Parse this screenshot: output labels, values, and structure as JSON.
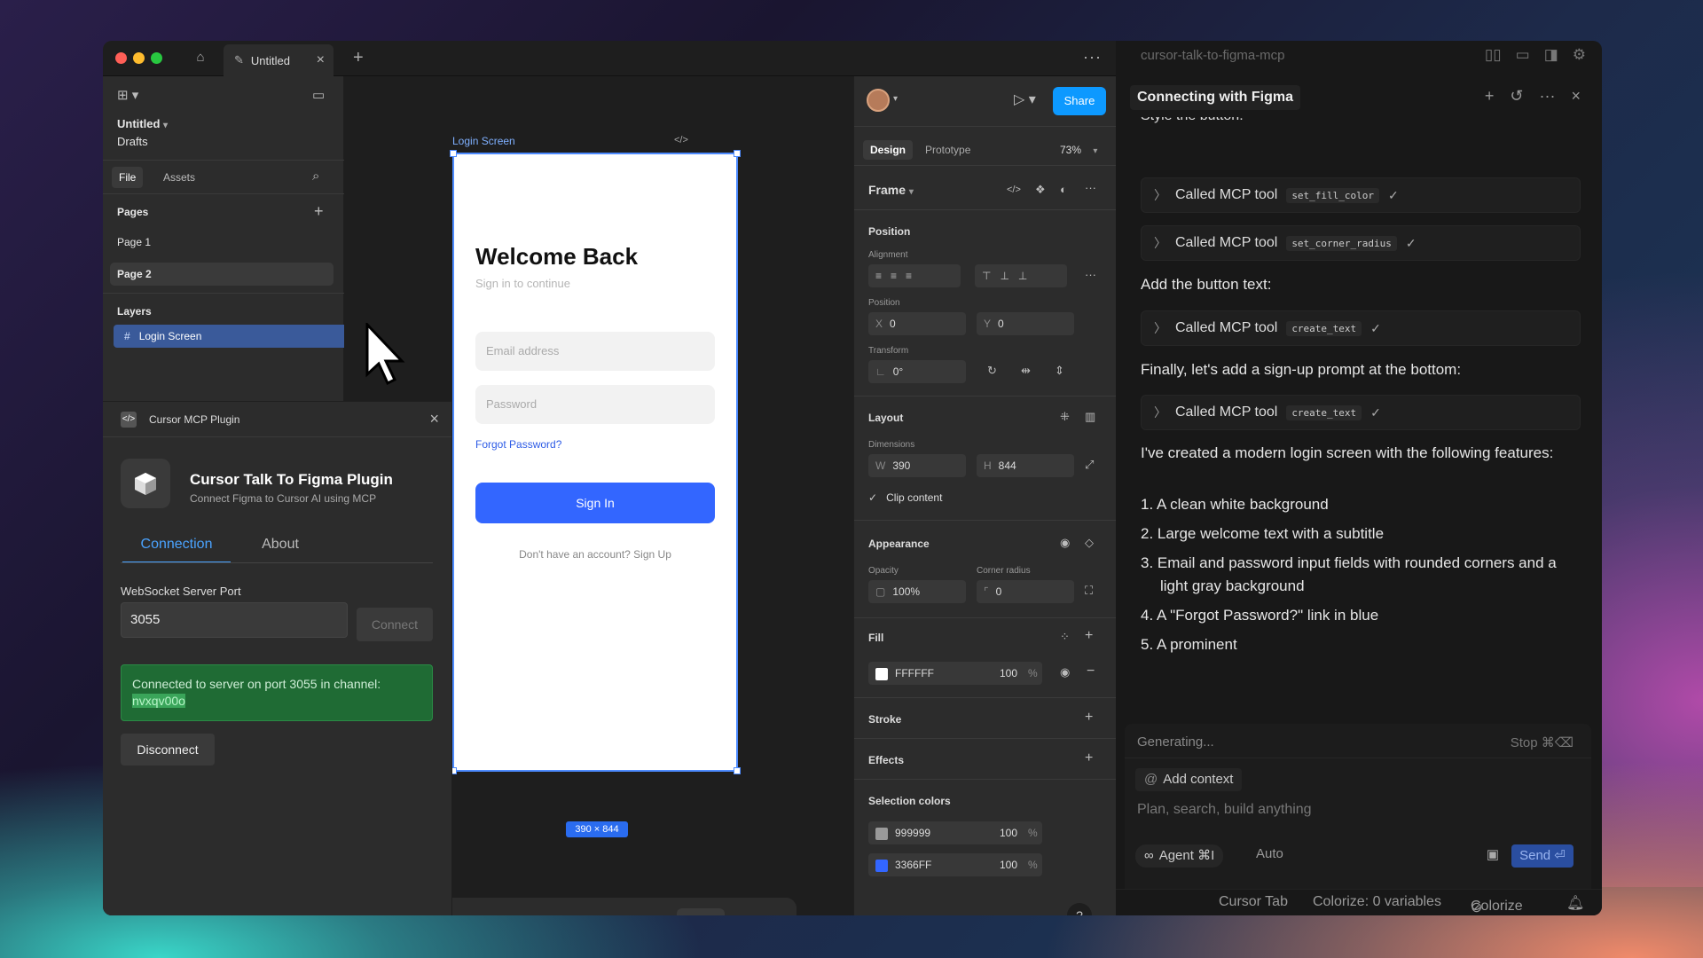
{
  "figma": {
    "tab_title": "Untitled",
    "file_name": "Untitled",
    "location": "Drafts",
    "panel_tabs": [
      "File",
      "Assets"
    ],
    "pages_label": "Pages",
    "pages": [
      "Page 1",
      "Page 2"
    ],
    "layers_label": "Layers",
    "layer_selected": "Login Screen",
    "plugin": {
      "window_title": "Cursor MCP Plugin",
      "title": "Cursor Talk To Figma Plugin",
      "subtitle": "Connect Figma to Cursor AI using MCP",
      "tabs": [
        "Connection",
        "About"
      ],
      "ws_label": "WebSocket Server Port",
      "ws_port": "3055",
      "connect_label": "Connect",
      "status_text": "Connected to server on port 3055 in channel:",
      "channel": "nvxqv00o",
      "disconnect_label": "Disconnect"
    },
    "canvas": {
      "frame_label": "Login Screen",
      "welcome": "Welcome Back",
      "subtitle": "Sign in to continue",
      "email_placeholder": "Email address",
      "password_placeholder": "Password",
      "forgot": "Forgot Password?",
      "signin": "Sign In",
      "signup": "Don't have an account? Sign Up",
      "dimensions_badge": "390 × 844"
    },
    "props": {
      "share": "Share",
      "tabs": [
        "Design",
        "Prototype"
      ],
      "zoom": "73%",
      "frame_label": "Frame",
      "position_label": "Position",
      "alignment_label": "Alignment",
      "position_sub": "Position",
      "x": "0",
      "y": "0",
      "transform_label": "Transform",
      "rotation": "0°",
      "layout_label": "Layout",
      "dimensions_label": "Dimensions",
      "w": "390",
      "h": "844",
      "clip_content": "Clip content",
      "appearance_label": "Appearance",
      "opacity_label": "Opacity",
      "opacity": "100%",
      "corner_label": "Corner radius",
      "corner": "0",
      "fill_label": "Fill",
      "fill_hex": "FFFFFF",
      "fill_opacity": "100",
      "stroke_label": "Stroke",
      "effects_label": "Effects",
      "selection_colors_label": "Selection colors",
      "selection_colors": [
        {
          "hex": "999999",
          "opacity": "100",
          "color": "#999999"
        },
        {
          "hex": "3366FF",
          "opacity": "100",
          "color": "#3366FF"
        }
      ],
      "percent": "%"
    }
  },
  "cursor": {
    "window_title": "cursor-talk-to-figma-mcp",
    "chat_title": "Connecting with Figma",
    "cut_text": "Style the button:",
    "tool_calls": [
      {
        "label": "Called MCP tool",
        "tool": "set_fill_color"
      },
      {
        "label": "Called MCP tool",
        "tool": "set_corner_radius"
      },
      {
        "label": "Called MCP tool",
        "tool": "create_text"
      },
      {
        "label": "Called MCP tool",
        "tool": "create_text"
      }
    ],
    "msg_button_text": "Add the button text:",
    "msg_signup": "Finally, let's add a sign-up prompt at the bottom:",
    "msg_summary": "I've created a modern login screen with the following features:",
    "features": [
      "1. A clean white background",
      "2. Large welcome text with a subtitle",
      "3. Email and password input fields with rounded corners and a light gray background",
      "4. A \"Forgot Password?\" link in blue",
      "5. A prominent"
    ],
    "generating": "Generating...",
    "stop": "Stop ⌘⌫",
    "add_context": "Add context",
    "input_placeholder": "Plan, search, build anything",
    "agent": "Agent ⌘I",
    "auto": "Auto",
    "send": "Send ⏎",
    "status": {
      "cursor_tab": "Cursor Tab",
      "colorize_vars": "Colorize: 0 variables",
      "colorize": "Colorize"
    }
  }
}
